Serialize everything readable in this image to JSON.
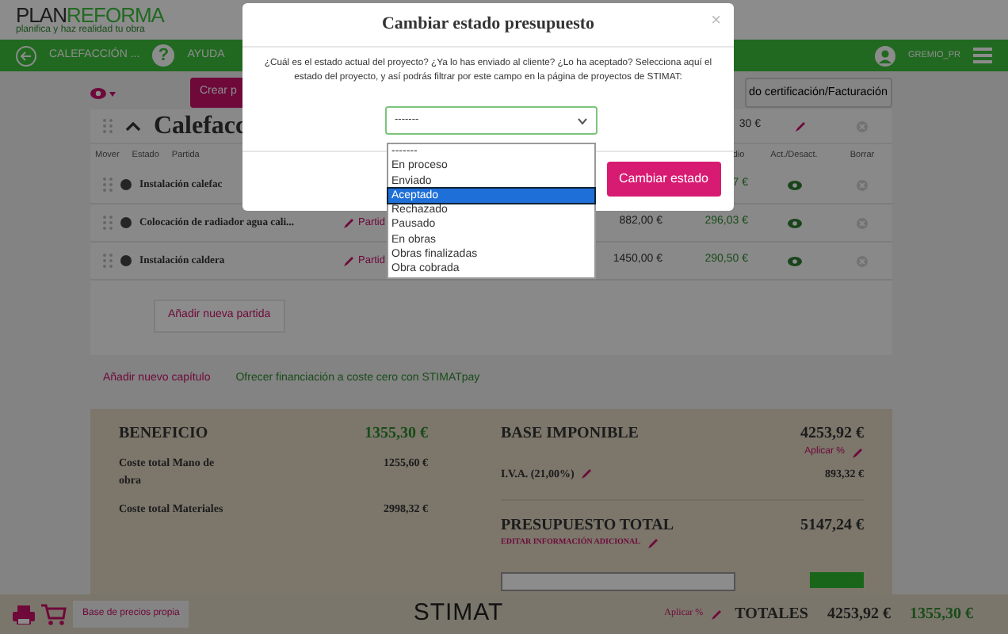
{
  "header": {
    "logo_dark": "PLAN",
    "logo_light": "REFORMA",
    "tagline": "planifica y haz realidad tu obra"
  },
  "navbar": {
    "back_label": "CALEFACCIÓN ...",
    "help_glyph": "?",
    "help_label": "AYUDA",
    "user": "GREMIO_PR"
  },
  "toolbar": {
    "create_button": "Crear p",
    "certification_button": "do certificación/Facturación"
  },
  "chapter": {
    "title": "Calefacc",
    "expanded": true,
    "total": "30 €",
    "columns": [
      "Mover",
      "Estado",
      "Partida"
    ],
    "right_columns": [
      "dio",
      "Act./Desact.",
      "Borrar"
    ],
    "rows": [
      {
        "name": "Instalación calefac",
        "link": "",
        "cost": "",
        "profit": "7 €",
        "active": true
      },
      {
        "name": "Colocación de radiador agua cali...",
        "link": "Partid",
        "cost": "882,00 €",
        "profit": "296,03 €",
        "active": true
      },
      {
        "name": "Instalación caldera",
        "link": "Partid",
        "cost": "1450,00 €",
        "profit": "290,50 €",
        "active": true
      }
    ],
    "add_button": "Añadir nueva partida"
  },
  "links": {
    "add_chapter": "Añadir nuevo capítulo",
    "financing": "Ofrecer financiación a coste cero con STIMATpay"
  },
  "summary": {
    "profit_label": "BENEFICIO",
    "profit": "1355,30 €",
    "labour_label": "Coste total Mano de obra",
    "labour": "1255,60 €",
    "materials_label": "Coste total Materiales",
    "materials": "2998,32 €",
    "tax_base_label": "BASE IMPONIBLE",
    "tax_base": "4253,92 €",
    "apply_percent": "Aplicar %",
    "vat_label": "I.V.A. (21,00%)",
    "vat": "893,32 €",
    "total_label": "PRESUPUESTO TOTAL",
    "total": "5147,24 €",
    "edit_info": "EDITAR INFORMACIÓN ADICIONAL"
  },
  "footer": {
    "price_base_button": "Base de precios propia",
    "logo": "STIMAT",
    "apply_percent": "Aplicar %",
    "totals_label": "TOTALES",
    "totals_base": "4253,92 €",
    "totals_profit": "1355,30 €"
  },
  "modal": {
    "title": "Cambiar estado presupuesto",
    "close": "×",
    "message": "¿Cuál es el estado actual del proyecto? ¿Ya lo has enviado al cliente? ¿Lo ha aceptado? Selecciona aquí el estado del proyecto, y así podrás filtrar por este campo en la página de proyectos de STIMAT:",
    "select_value": "-------",
    "options": [
      {
        "label": "-------",
        "selected": false
      },
      {
        "label": "En proceso",
        "selected": false
      },
      {
        "label": "Enviado",
        "selected": false
      },
      {
        "label": "Aceptado",
        "selected": true
      },
      {
        "label": "Rechazado",
        "selected": false
      },
      {
        "label": "Pausado",
        "selected": false
      },
      {
        "label": "En obras",
        "selected": false
      },
      {
        "label": "Obras finalizadas",
        "selected": false
      },
      {
        "label": "Obra cobrada",
        "selected": false
      }
    ],
    "submit": "Cambiar estado"
  }
}
